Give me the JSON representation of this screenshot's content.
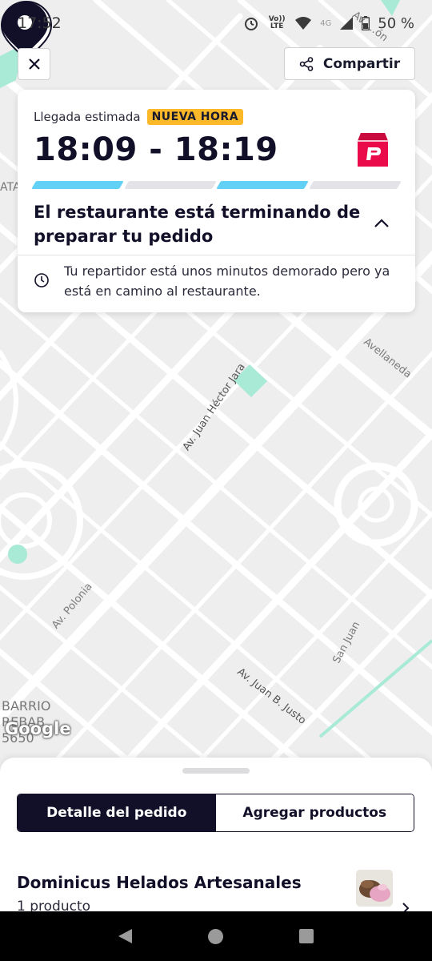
{
  "status_bar": {
    "time": "17:52",
    "volte_label": "Vo)) LTE",
    "network_label": "4G",
    "battery": "50 %"
  },
  "top_bar": {
    "close_icon": "close-icon",
    "share_label": "Compartir",
    "share_icon": "share-icon"
  },
  "eta_card": {
    "label": "Llegada estimada",
    "badge": "NUEVA HORA",
    "time_range": "18:09 - 18:19",
    "brand_icon": "pedidosya-bag-icon",
    "progress": [
      1,
      0,
      1,
      0
    ],
    "progress_colors": {
      "filled": "#62d1f5",
      "empty": "#e4e4e8"
    },
    "status_title": "El restaurante está terminando de preparar tu pedido",
    "note": "Tu repartidor está unos minutos demorado pero ya está en camino al restaurante."
  },
  "map": {
    "labels": {
      "avellaneda": "Avellaneda",
      "hector_jara": "Av. Juan Héctor Jara",
      "polonia": "Av. Polonia",
      "san_juan": "San Juan",
      "justo": "Av. Juan B. Justo",
      "barrio": "BARRIO REBAB 5650",
      "ata": "ATA",
      "av_top": "Av. ...ón",
      "google": "Google"
    }
  },
  "sheet": {
    "tabs": [
      {
        "label": "Detalle del pedido",
        "active": true
      },
      {
        "label": "Agregar productos",
        "active": false
      }
    ],
    "restaurant_name": "Dominicus Helados Artesanales",
    "product_count": "1 producto"
  },
  "colors": {
    "primary_dark": "#121028",
    "brand_red": "#ea0c4a",
    "badge_yellow": "#fbb829",
    "park_green": "#a8ead6"
  }
}
